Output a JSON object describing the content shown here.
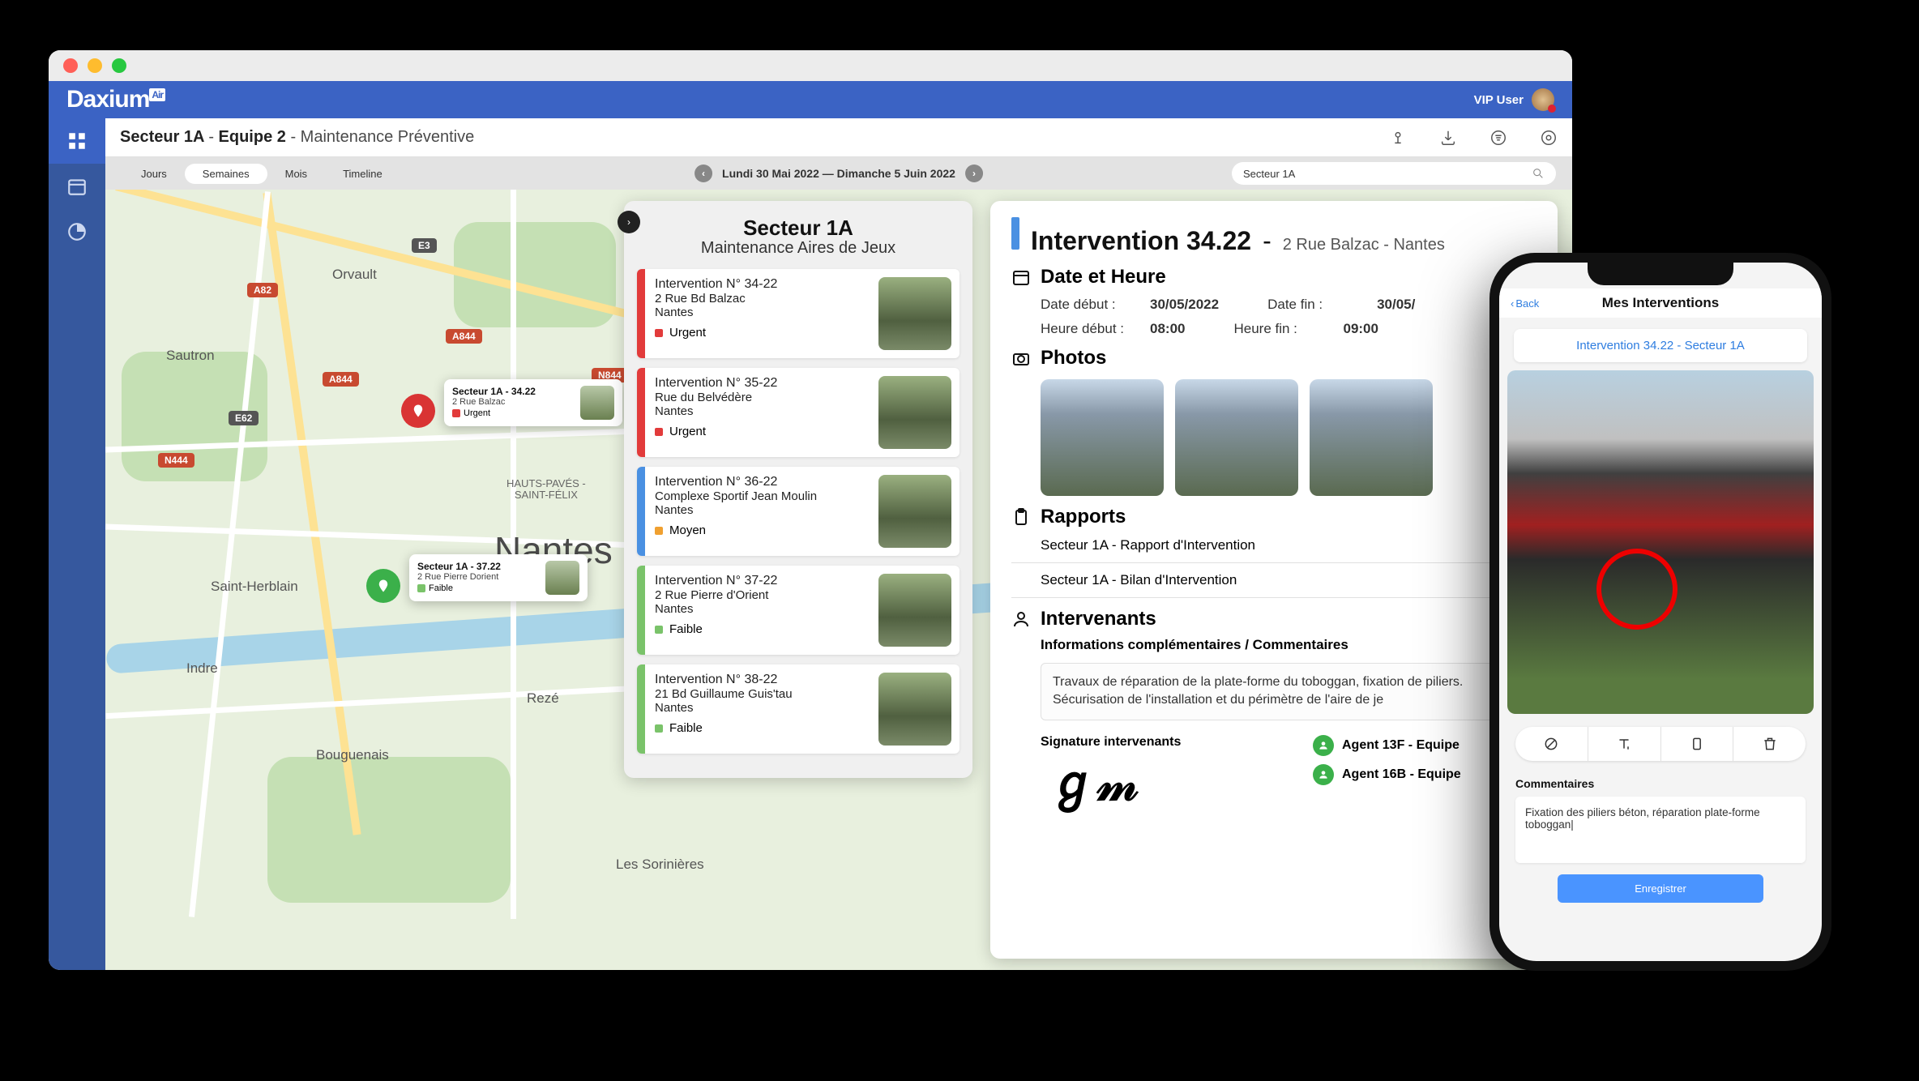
{
  "brand": "Daxium",
  "brand_suffix": "Air",
  "user_label": "VIP User",
  "breadcrumb": {
    "sector": "Secteur 1A",
    "team": "Equipe 2",
    "task": "Maintenance Préventive"
  },
  "view_tabs": {
    "days": "Jours",
    "weeks": "Semaines",
    "months": "Mois",
    "timeline": "Timeline"
  },
  "date_range": "Lundi 30 Mai 2022 — Dimanche 5 Juin 2022",
  "search_value": "Secteur 1A",
  "map": {
    "city_main": "Nantes",
    "towns": [
      "Orvault",
      "Sautron",
      "Saint-Herblain",
      "Indre",
      "Bouguenais",
      "Rezé",
      "Les Sorinières"
    ],
    "district": "HAUTS-PAVÉS -\nSAINT-FÉLIX",
    "shields": {
      "e3": "E3",
      "a844_1": "A844",
      "a844_2": "A844",
      "n444": "N444",
      "a82": "A82",
      "e62": "E62",
      "n844": "N844"
    },
    "callout1": {
      "title": "Secteur 1A - 34.22",
      "addr": "2 Rue Balzac",
      "status": "Urgent"
    },
    "callout2": {
      "title": "Secteur 1A - 37.22",
      "addr": "2 Rue Pierre Dorient",
      "status": "Faible"
    }
  },
  "sector_panel": {
    "title": "Secteur 1A",
    "subtitle": "Maintenance Aires de Jeux",
    "items": [
      {
        "num": "Intervention N° 34-22",
        "addr": "2 Rue Bd Balzac",
        "city": "Nantes",
        "status": "Urgent",
        "level": "red"
      },
      {
        "num": "Intervention N° 35-22",
        "addr": "Rue du Belvédère",
        "city": "Nantes",
        "status": "Urgent",
        "level": "red"
      },
      {
        "num": "Intervention N° 36-22",
        "addr": "Complexe Sportif Jean Moulin",
        "city": "Nantes",
        "status": "Moyen",
        "level": "org"
      },
      {
        "num": "Intervention N° 37-22",
        "addr": "2 Rue Pierre d'Orient",
        "city": "Nantes",
        "status": "Faible",
        "level": "grn"
      },
      {
        "num": "Intervention N° 38-22",
        "addr": "21 Bd Guillaume Guis'tau",
        "city": "Nantes",
        "status": "Faible",
        "level": "grn"
      }
    ]
  },
  "detail": {
    "title": "Intervention 34.22",
    "sep": "-",
    "addr": "2 Rue Balzac - Nantes",
    "date_heading": "Date et Heure",
    "date_start_lbl": "Date début :",
    "date_start_val": "30/05/2022",
    "date_end_lbl": "Date fin :",
    "date_end_val": "30/05/",
    "time_start_lbl": "Heure début :",
    "time_start_val": "08:00",
    "time_end_lbl": "Heure fin :",
    "time_end_val": "09:00",
    "photos_heading": "Photos",
    "rapports_heading": "Rapports",
    "rapport1": "Secteur 1A - Rapport d'Intervention",
    "rapport2": "Secteur 1A - Bilan d'Intervention",
    "intervenants_heading": "Intervenants",
    "info_subtitle": "Informations complémentaires / Commentaires",
    "comment": "Travaux de réparation de la plate-forme du toboggan, fixation de piliers. Sécurisation de l'installation et du périmètre de l'aire de je",
    "sign_title": "Signature intervenants",
    "agent1": "Agent 13F - Equipe ",
    "agent2": "Agent 16B - Equipe "
  },
  "phone": {
    "back": "Back",
    "title": "Mes Interventions",
    "chip": "Intervention 34.22 - Secteur 1A",
    "comments_label": "Commentaires",
    "comment_text": "Fixation des piliers béton, réparation plate-forme toboggan|",
    "save": "Enregistrer"
  }
}
